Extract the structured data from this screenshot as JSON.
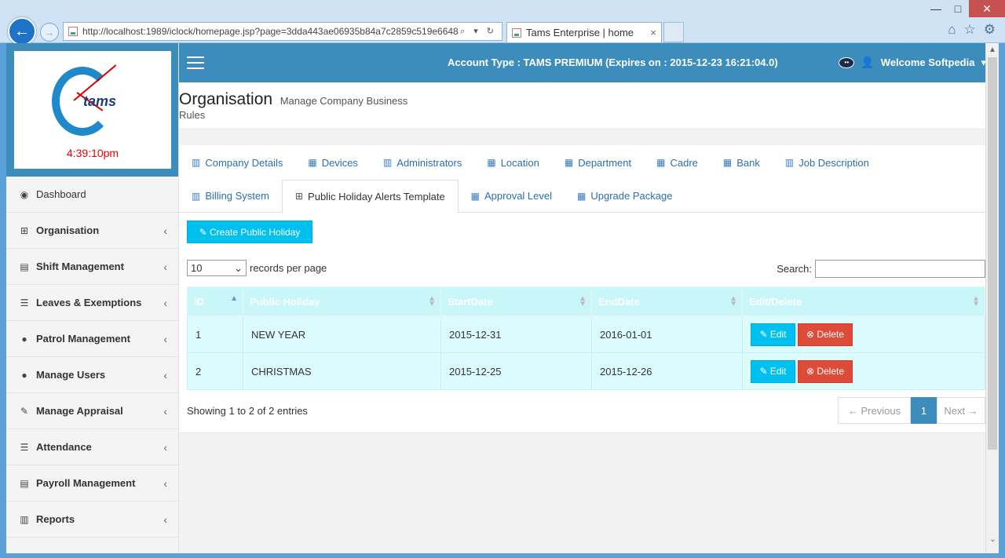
{
  "browser": {
    "address": "http://localhost:1989/iclock/homepage.jsp?page=3dda443ae06935b84a7c2859c519e6648",
    "tab_title": "Tams Enterprise | home",
    "tab_close": "×",
    "back": "←",
    "forward": "→",
    "win_min": "—",
    "win_max": "□",
    "win_close": "✕",
    "addr_tools": "⌕ ▾ ↻",
    "home_glyph": "⌂",
    "star_glyph": "☆",
    "gear_glyph": "⚙"
  },
  "logo": {
    "word": "tams",
    "clock_time": "4:39:10pm"
  },
  "topbar": {
    "account_type": "Account Type : TAMS PREMIUM (Expires on : 2015-12-23 16:21:04.0)",
    "welcome": "Welcome Softpedia",
    "caret": "▾"
  },
  "sidebar": {
    "items": [
      {
        "label": "Dashboard",
        "icon": "◉",
        "chev": ""
      },
      {
        "label": "Organisation",
        "icon": "⊞",
        "chev": "‹"
      },
      {
        "label": "Shift Management",
        "icon": "▤",
        "chev": "‹"
      },
      {
        "label": "Leaves & Exemptions",
        "icon": "☰",
        "chev": "‹"
      },
      {
        "label": "Patrol Management",
        "icon": "●",
        "chev": "‹"
      },
      {
        "label": "Manage Users",
        "icon": "●",
        "chev": "‹"
      },
      {
        "label": "Manage Appraisal",
        "icon": "✎",
        "chev": "‹"
      },
      {
        "label": "Attendance",
        "icon": "☰",
        "chev": "‹"
      },
      {
        "label": "Payroll Management",
        "icon": "▤",
        "chev": "‹"
      },
      {
        "label": "Reports",
        "icon": "▥",
        "chev": "‹"
      }
    ]
  },
  "header": {
    "title": "Organisation",
    "subtitle": "Manage Company Business",
    "subtitle2": "Rules"
  },
  "tabs": {
    "row1": [
      {
        "label": "Company Details",
        "icon": "▥"
      },
      {
        "label": "Devices",
        "icon": "▦"
      },
      {
        "label": "Administrators",
        "icon": "▥"
      },
      {
        "label": "Location",
        "icon": "▦"
      },
      {
        "label": "Department",
        "icon": "▦"
      },
      {
        "label": "Cadre",
        "icon": "▦"
      },
      {
        "label": "Bank",
        "icon": "▦"
      },
      {
        "label": "Job Description",
        "icon": "▥"
      }
    ],
    "row2": [
      {
        "label": "Billing System",
        "icon": "▥"
      },
      {
        "label": "Public Holiday Alerts Template",
        "icon": "⊞"
      },
      {
        "label": "Approval Level",
        "icon": "▦"
      },
      {
        "label": "Upgrade Package",
        "icon": "▦"
      }
    ]
  },
  "toolbar": {
    "create_label": "✎ Create Public Holiday",
    "records_value": "10",
    "records_caret": "⌄",
    "records_suffix": "records per page",
    "search_label": "Search:",
    "search_value": ""
  },
  "table": {
    "headers": [
      "ID",
      "Public Holiday",
      "StartDate",
      "EndDate",
      "Edit/Delete"
    ],
    "rows": [
      {
        "id": "1",
        "holiday": "NEW YEAR",
        "start": "2015-12-31",
        "end": "2016-01-01"
      },
      {
        "id": "2",
        "holiday": "CHRISTMAS",
        "start": "2015-12-25",
        "end": "2015-12-26"
      }
    ],
    "edit_label": "✎ Edit",
    "delete_label": "⊗ Delete"
  },
  "footer": {
    "info": "Showing 1 to 2 of 2 entries",
    "prev": "← Previous",
    "page": "1",
    "next": "Next →"
  },
  "scroll": {
    "up": "▲",
    "down": "⌄"
  },
  "colors": {
    "primary": "#3c8dbc",
    "info": "#00c0ef",
    "danger": "#dd4b39",
    "table_row": "#dcfbfd"
  }
}
